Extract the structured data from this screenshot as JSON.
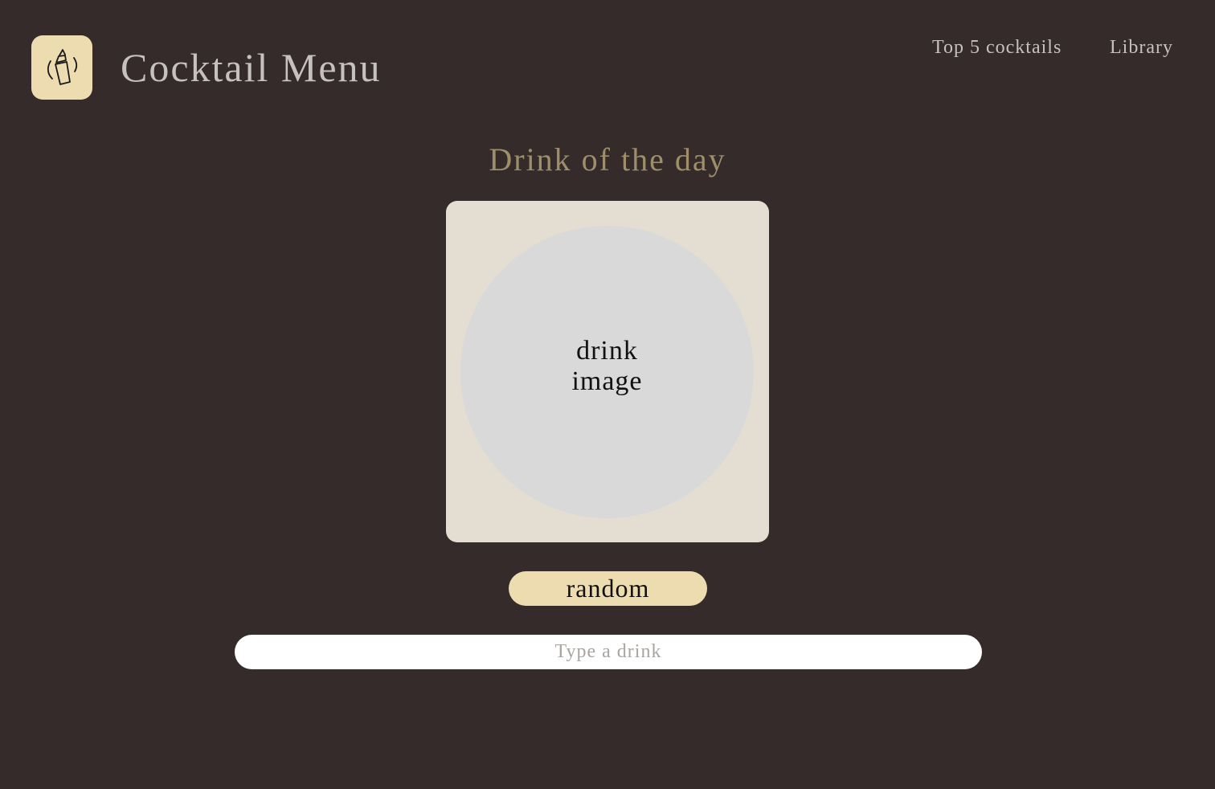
{
  "header": {
    "app_title": "Cocktail Menu",
    "logo_icon": "cocktail-shaker-icon"
  },
  "nav": {
    "items": [
      {
        "label": "Top 5 cocktails"
      },
      {
        "label": "Library"
      }
    ]
  },
  "main": {
    "section_title": "Drink of the day",
    "drink_image_label_line1": "drink",
    "drink_image_label_line2": "image",
    "random_button_label": "random",
    "search": {
      "value": "",
      "placeholder": "Type a drink"
    }
  },
  "colors": {
    "background": "#342b2a",
    "accent": "#eedcb1",
    "card": "#e4ded2",
    "image_placeholder": "#d9d9d9",
    "section_title": "#9e8f6a",
    "header_text": "#c6c1be"
  }
}
